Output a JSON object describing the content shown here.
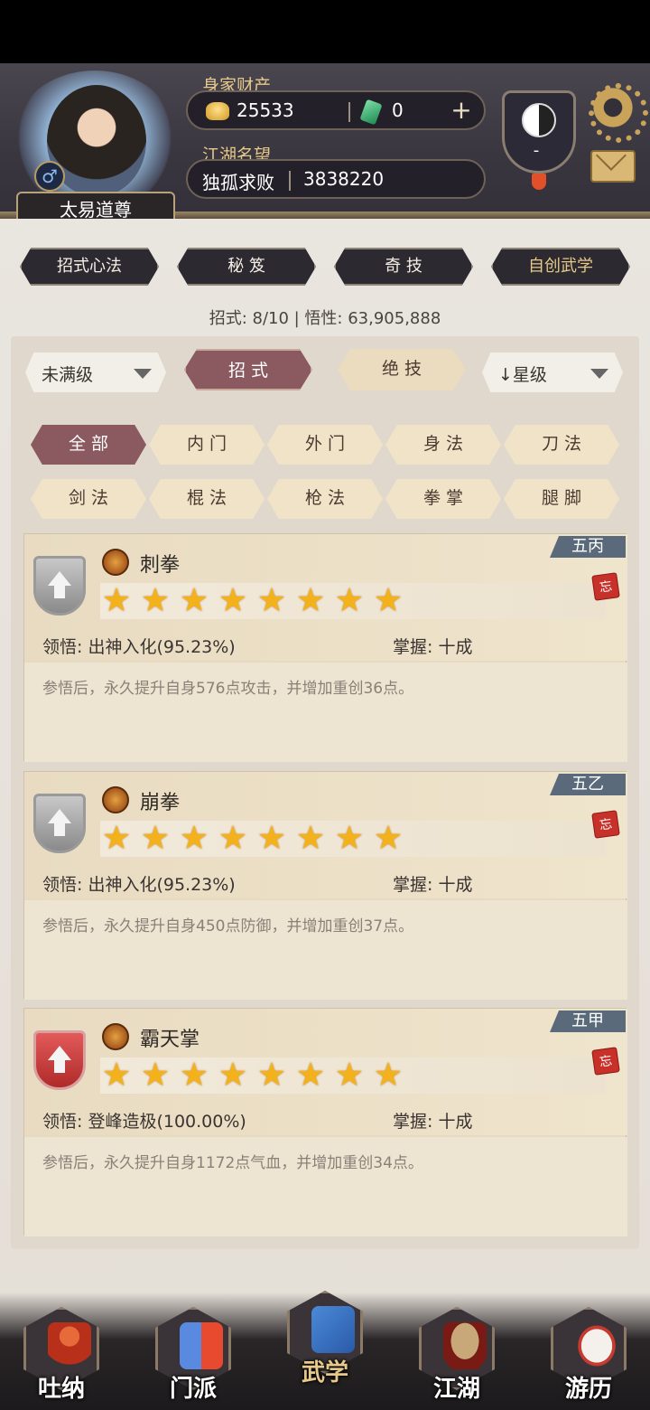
{
  "header": {
    "player_name": "太易道尊",
    "gender_icon": "male-icon",
    "wealth_label": "身家财产",
    "gold": "25533",
    "jade": "0",
    "plus": "+",
    "fame_label": "江湖名望",
    "fame_title": "独孤求败",
    "fame_value": "3838220",
    "taiji_value": "-"
  },
  "top_tabs": [
    "招式心法",
    "秘 笈",
    "奇 技",
    "自创武学"
  ],
  "stats": "招式: 8/10 | 悟性: 63,905,888",
  "filters": {
    "level": "未满级",
    "star": "↓星级",
    "seg_moves": "招 式",
    "seg_ult": "绝 技"
  },
  "categories": [
    "全 部",
    "内 门",
    "外 门",
    "身 法",
    "刀 法",
    "剑 法",
    "棍 法",
    "枪 法",
    "拳 掌",
    "腿 脚"
  ],
  "active_category": 0,
  "skills": [
    {
      "name": "刺拳",
      "tag": "五丙",
      "stars": 8,
      "realm": "领悟: 出神入化(95.23%)",
      "mastery": "掌握: 十成",
      "desc": "参悟后，永久提升自身576点攻击，并增加重创36点。",
      "forget": "忘",
      "badge": "silver"
    },
    {
      "name": "崩拳",
      "tag": "五乙",
      "stars": 8,
      "realm": "领悟: 出神入化(95.23%)",
      "mastery": "掌握: 十成",
      "desc": "参悟后，永久提升自身450点防御，并增加重创37点。",
      "forget": "忘",
      "badge": "silver"
    },
    {
      "name": "霸天掌",
      "tag": "五甲",
      "stars": 8,
      "realm": "领悟: 登峰造极(100.00%)",
      "mastery": "掌握: 十成",
      "desc": "参悟后，永久提升自身1172点气血，并增加重创34点。",
      "forget": "忘",
      "badge": "red"
    }
  ],
  "bottom_nav": [
    {
      "label": "吐纳",
      "icon": "meditation-icon"
    },
    {
      "label": "门派",
      "icon": "sect-icon"
    },
    {
      "label": "武学",
      "icon": "martial-arts-book-icon",
      "active": true
    },
    {
      "label": "江湖",
      "icon": "straw-hat-icon"
    },
    {
      "label": "游历",
      "icon": "horse-icon"
    }
  ],
  "colors": {
    "accent": "#8a5a60",
    "gold_text": "#e7c98a",
    "star": "#f3b21c",
    "tag": "#5a6a7a"
  }
}
